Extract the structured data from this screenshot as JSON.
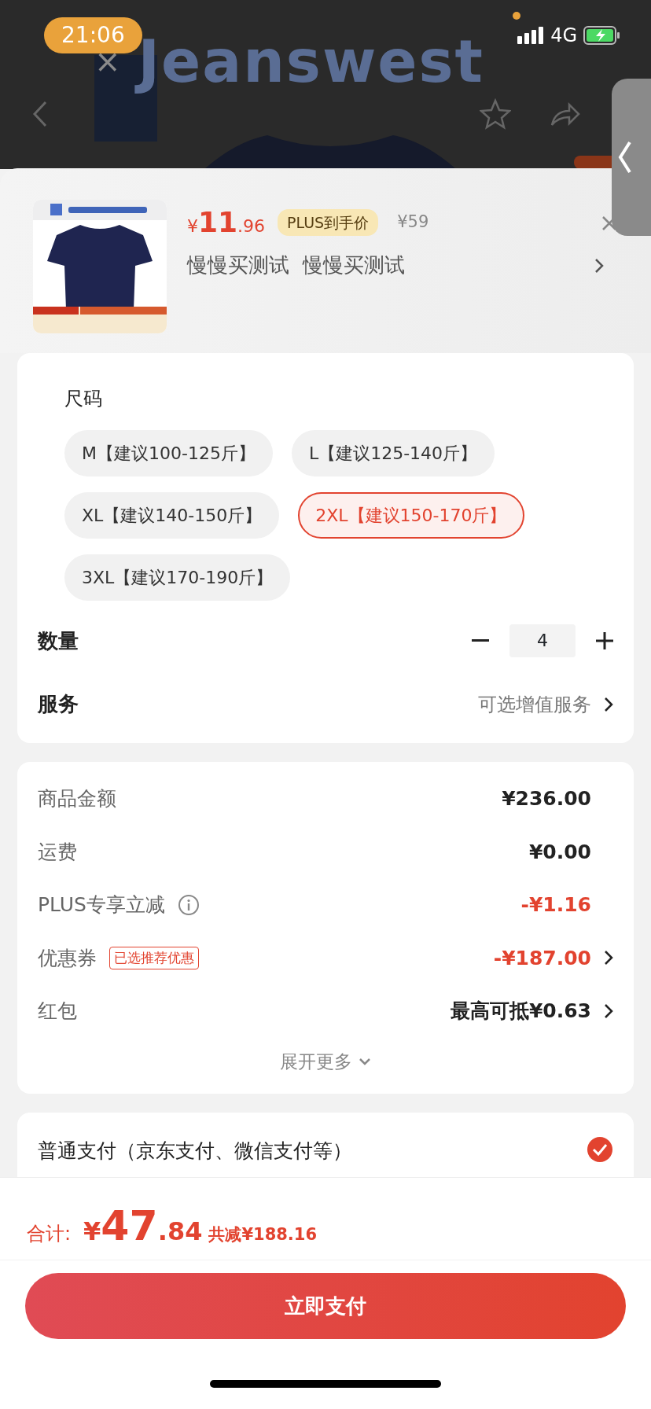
{
  "status_bar": {
    "time": "21:06",
    "network": "4G"
  },
  "background": {
    "separator": "×",
    "brand": "Jeanswest"
  },
  "product": {
    "currency": "¥",
    "price_int": "11",
    "price_dec": ".96",
    "price_tag": "PLUS到手价",
    "original_price": "¥59",
    "title": "慢慢买测试  慢慢买测试"
  },
  "sizes": {
    "label": "尺码",
    "options": [
      {
        "label": "M【建议100-125斤】",
        "selected": false
      },
      {
        "label": "L【建议125-140斤】",
        "selected": false
      },
      {
        "label": "XL【建议140-150斤】",
        "selected": false
      },
      {
        "label": "2XL【建议150-170斤】",
        "selected": true
      },
      {
        "label": "3XL【建议170-190斤】",
        "selected": false
      }
    ]
  },
  "quantity": {
    "label": "数量",
    "value": "4"
  },
  "service": {
    "label": "服务",
    "value": "可选增值服务"
  },
  "costs": [
    {
      "label": "商品金额",
      "value": "¥236.00",
      "discount": false,
      "info": false,
      "chevron": false
    },
    {
      "label": "运费",
      "value": "¥0.00",
      "discount": false,
      "info": false,
      "chevron": false
    },
    {
      "label": "PLUS专享立减",
      "value": "-¥1.16",
      "discount": true,
      "info": true,
      "chevron": false
    },
    {
      "label": "优惠券",
      "tag": "已选推荐优惠",
      "value": "-¥187.00",
      "discount": true,
      "info": false,
      "chevron": true
    },
    {
      "label": "红包",
      "value": "最高可抵¥0.63",
      "discount": false,
      "info": false,
      "chevron": true
    }
  ],
  "expand": "展开更多",
  "payment": {
    "label": "普通支付（京东支付、微信支付等）",
    "selected": true
  },
  "total": {
    "label": "合计:",
    "currency": "¥",
    "int": "47",
    "dec": ".84",
    "saving": "共减¥188.16"
  },
  "pay_button": "立即支付"
}
